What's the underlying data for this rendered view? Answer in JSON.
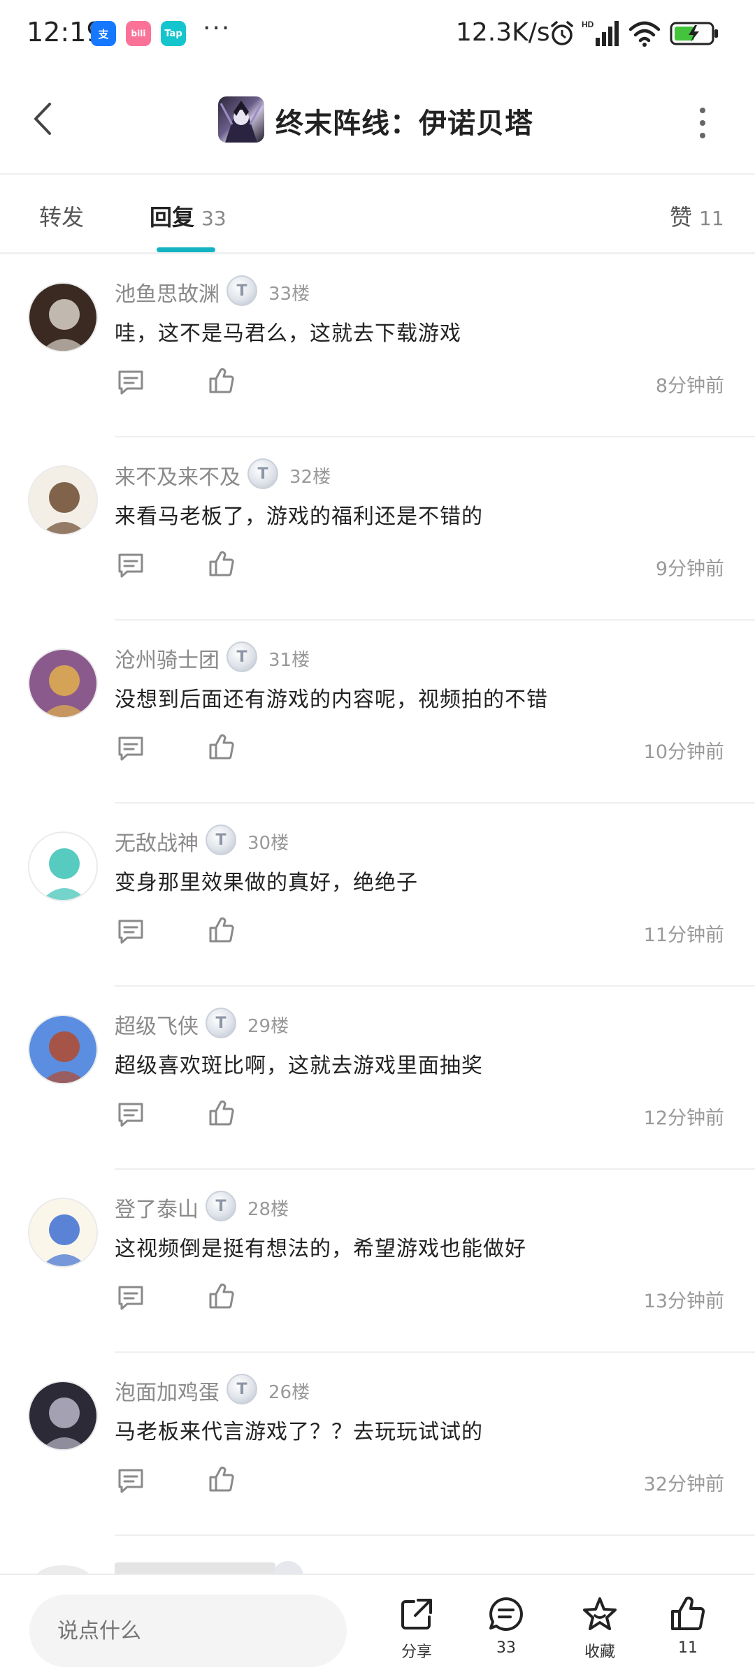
{
  "status_bar": {
    "time": "12:19",
    "app_icons": [
      {
        "name": "alipay-icon",
        "glyph": "支",
        "color": "#1677ff"
      },
      {
        "name": "bilibili-icon",
        "glyph": "bili",
        "color": "#fb7299"
      },
      {
        "name": "taptap-icon",
        "glyph": "Tap",
        "color": "#15c5ce"
      }
    ],
    "more": "···",
    "network_speed": "12.3K/s",
    "signal_label": "HD",
    "battery_color": "#44c33c"
  },
  "header": {
    "title": "终末阵线：伊诺贝塔",
    "back_icon": "chevron-left-icon",
    "more_icon": "more-vertical-icon"
  },
  "tabs": {
    "forward": {
      "label": "转发"
    },
    "reply": {
      "label": "回复",
      "count": "33"
    },
    "like": {
      "label": "赞",
      "count": "11"
    },
    "active_color": "#14b3c2"
  },
  "comments": [
    {
      "username": "池鱼思故渊",
      "badge": "T",
      "floor": "33楼",
      "text": "哇，这不是马君么，这就去下载游戏",
      "time": "8分钟前",
      "avatar_colors": [
        "#3a2a22",
        "#d9d2c8"
      ]
    },
    {
      "username": "来不及来不及",
      "badge": "T",
      "floor": "32楼",
      "text": "来看马老板了，游戏的福利还是不错的",
      "time": "9分钟前",
      "avatar_colors": [
        "#f3efe6",
        "#6b4a2e"
      ]
    },
    {
      "username": "沧州骑士团",
      "badge": "T",
      "floor": "31楼",
      "text": "没想到后面还有游戏的内容呢，视频拍的不错",
      "time": "10分钟前",
      "avatar_colors": [
        "#8b5a8c",
        "#e2b04d"
      ]
    },
    {
      "username": "无敌战神",
      "badge": "T",
      "floor": "30楼",
      "text": "变身那里效果做的真好，绝绝子",
      "time": "11分钟前",
      "avatar_colors": [
        "#ffffff",
        "#39c2b5"
      ]
    },
    {
      "username": "超级飞侠",
      "badge": "T",
      "floor": "29楼",
      "text": "超级喜欢斑比啊，这就去游戏里面抽奖",
      "time": "12分钟前",
      "avatar_colors": [
        "#5b8ee0",
        "#b44a2c"
      ]
    },
    {
      "username": "登了泰山",
      "badge": "T",
      "floor": "28楼",
      "text": "这视频倒是挺有想法的，希望游戏也能做好",
      "time": "13分钟前",
      "avatar_colors": [
        "#fbf6ea",
        "#3d6fd1"
      ]
    },
    {
      "username": "泡面加鸡蛋",
      "badge": "T",
      "floor": "26楼",
      "text": "马老板来代言游戏了？？去玩玩试试的",
      "time": "32分钟前",
      "avatar_colors": [
        "#2c2a36",
        "#b9b6c8"
      ]
    }
  ],
  "bottom_bar": {
    "input_placeholder": "说点什么",
    "share_label": "分享",
    "comments_count": "33",
    "favorite_label": "收藏",
    "likes_count": "11"
  }
}
